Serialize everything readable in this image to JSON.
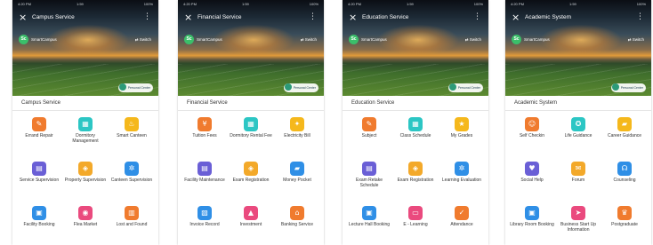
{
  "screens": [
    {
      "title": "Campus Service",
      "section": "Campus Service",
      "tiles": [
        {
          "label": "Errand Repair",
          "icon": "wrench-icon",
          "color": "#f07b2e"
        },
        {
          "label": "Dormitory Management",
          "icon": "building-icon",
          "color": "#2cc6c4"
        },
        {
          "label": "Smart Canteen",
          "icon": "utensils-icon",
          "color": "#f5b81c"
        },
        {
          "label": "Service Supervision",
          "icon": "clipboard-icon",
          "color": "#6a5fd6"
        },
        {
          "label": "Property Supervision",
          "icon": "shield-icon",
          "color": "#f3a92a"
        },
        {
          "label": "Canteen Supervision",
          "icon": "gear-icon",
          "color": "#2f8fe6"
        },
        {
          "label": "Facility Booking",
          "icon": "calendar-icon",
          "color": "#2f8fe6"
        },
        {
          "label": "Flea Market",
          "icon": "bag-icon",
          "color": "#ea4a7e"
        },
        {
          "label": "Lost and Found",
          "icon": "box-icon",
          "color": "#f07b2e"
        }
      ]
    },
    {
      "title": "Financial Service",
      "section": "Financial Service",
      "tiles": [
        {
          "label": "Tuition Fees",
          "icon": "coins-icon",
          "color": "#f07b2e"
        },
        {
          "label": "Dormitory Rental Fee",
          "icon": "building-icon",
          "color": "#2cc6c4"
        },
        {
          "label": "Electricity Bill",
          "icon": "bulb-icon",
          "color": "#f5b81c"
        },
        {
          "label": "Facility Maintenance",
          "icon": "clipboard-icon",
          "color": "#6a5fd6"
        },
        {
          "label": "Exam Registration",
          "icon": "shield-icon",
          "color": "#f3a92a"
        },
        {
          "label": "Money Pocket",
          "icon": "wallet-icon",
          "color": "#2f8fe6"
        },
        {
          "label": "Invoice Record",
          "icon": "receipt-icon",
          "color": "#2f8fe6"
        },
        {
          "label": "Investment",
          "icon": "chart-icon",
          "color": "#ea4a7e"
        },
        {
          "label": "Banking Service",
          "icon": "bank-icon",
          "color": "#f07b2e"
        }
      ]
    },
    {
      "title": "Education Service",
      "section": "Education Service",
      "tiles": [
        {
          "label": "Subject",
          "icon": "book-icon",
          "color": "#f07b2e"
        },
        {
          "label": "Class Schedule",
          "icon": "calendar-icon",
          "color": "#2cc6c4"
        },
        {
          "label": "My Grades",
          "icon": "award-icon",
          "color": "#f5b81c"
        },
        {
          "label": "Exam Retake Schedule",
          "icon": "clipboard-icon",
          "color": "#6a5fd6"
        },
        {
          "label": "Exam Registration",
          "icon": "shield-icon",
          "color": "#f3a92a"
        },
        {
          "label": "Learning Evaluation",
          "icon": "star-icon",
          "color": "#2f8fe6"
        },
        {
          "label": "Lecture Hall Booking",
          "icon": "door-icon",
          "color": "#2f8fe6"
        },
        {
          "label": "E - Learning",
          "icon": "laptop-icon",
          "color": "#ea4a7e"
        },
        {
          "label": "Attendance",
          "icon": "check-icon",
          "color": "#f07b2e"
        }
      ]
    },
    {
      "title": "Academic System",
      "section": "Academic System",
      "tiles": [
        {
          "label": "Self Checkin",
          "icon": "person-icon",
          "color": "#f07b2e"
        },
        {
          "label": "Life Guidance",
          "icon": "compass-icon",
          "color": "#2cc6c4"
        },
        {
          "label": "Career Guidance",
          "icon": "briefcase-icon",
          "color": "#f5b81c"
        },
        {
          "label": "Social Help",
          "icon": "heart-icon",
          "color": "#6a5fd6"
        },
        {
          "label": "Forum",
          "icon": "chat-icon",
          "color": "#f3a92a"
        },
        {
          "label": "Counseling",
          "icon": "headset-icon",
          "color": "#2f8fe6"
        },
        {
          "label": "Library Room Booking",
          "icon": "book-icon",
          "color": "#2f8fe6"
        },
        {
          "label": "Business Start Up Information",
          "icon": "rocket-icon",
          "color": "#ea4a7e"
        },
        {
          "label": "Postgraduate",
          "icon": "cap-icon",
          "color": "#f07b2e"
        }
      ]
    }
  ],
  "common": {
    "status_left": "4:20 PM",
    "status_center": "1:59",
    "status_right": "100%",
    "campus_name": "SmartCampus",
    "avatar_letter": "Sc",
    "switch_label": "Switch",
    "personal_label": "Personal Center"
  }
}
